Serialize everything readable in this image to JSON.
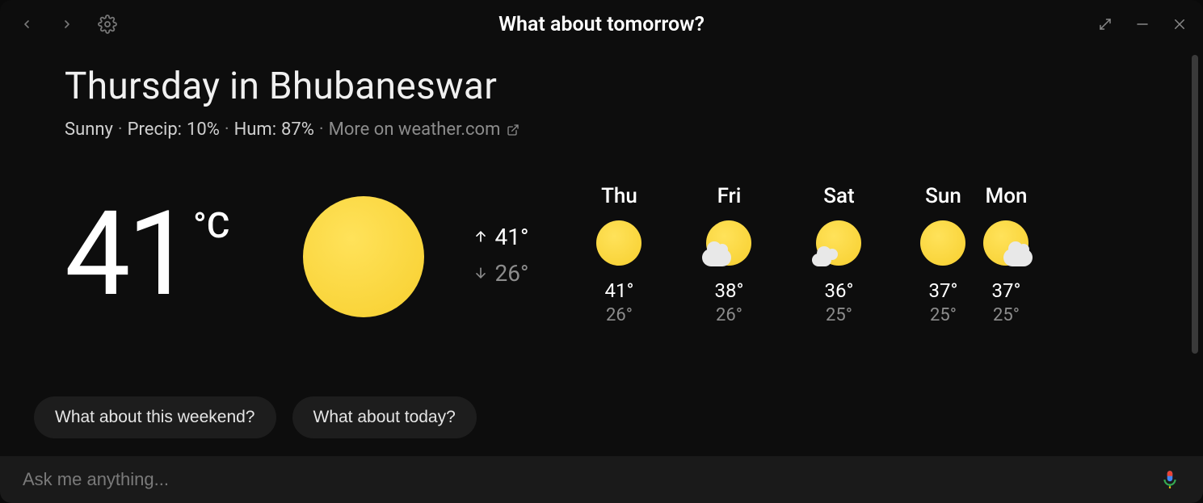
{
  "header": {
    "title": "What about tomorrow?"
  },
  "page": {
    "heading": "Thursday in Bhubaneswar",
    "condition": "Sunny",
    "precip_label": "Precip:",
    "precip_value": "10%",
    "hum_label": "Hum:",
    "hum_value": "87%",
    "more_label": "More on weather.com",
    "sep": "·"
  },
  "current": {
    "temp": "41",
    "unit": "°C",
    "high": "41°",
    "low": "26°",
    "icon": "sunny"
  },
  "forecast": [
    {
      "day": "Thu",
      "icon": "sunny",
      "hi": "41°",
      "lo": "26°"
    },
    {
      "day": "Fri",
      "icon": "partly-cloudy-left",
      "hi": "38°",
      "lo": "26°"
    },
    {
      "day": "Sat",
      "icon": "partly-cloudy-small",
      "hi": "36°",
      "lo": "25°"
    },
    {
      "day": "Sun",
      "icon": "sunny",
      "hi": "37°",
      "lo": "25°"
    },
    {
      "day": "Mon",
      "icon": "partly-cloudy-right",
      "hi": "37°",
      "lo": "25°"
    }
  ],
  "chips": [
    "What about this weekend?",
    "What about today?"
  ],
  "input": {
    "placeholder": "Ask me anything..."
  }
}
